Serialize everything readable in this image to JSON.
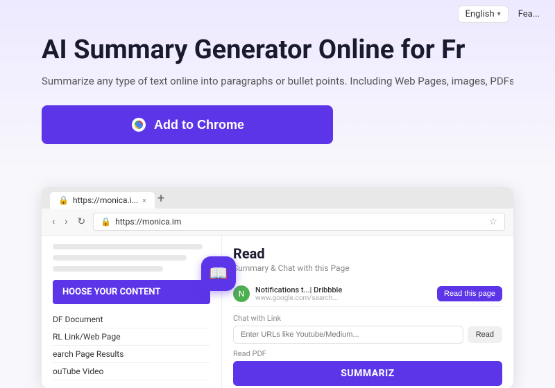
{
  "nav": {
    "language": "English",
    "chevron": "▾",
    "features": "Fea..."
  },
  "hero": {
    "title": "AI Summary Generator Online for Fr",
    "subtitle": "Summarize any type of text online into paragraphs or bullet points. Including Web Pages, images, PDFs, and YouTube"
  },
  "cta": {
    "add_to_chrome": "Add to Chrome"
  },
  "browser": {
    "traffic_lights": [
      "red",
      "yellow",
      "green"
    ],
    "tab_url": "https://monica.i...",
    "tab_close": "×",
    "tab_add": "+",
    "address": "https://monica.im"
  },
  "left_panel": {
    "choose_label": "HOOSE YOUR CONTENT",
    "menu_items": [
      "DF Document",
      "RL Link/Web Page",
      "earch Page Results",
      "ouTube Video"
    ]
  },
  "right_panel": {
    "title": "Read",
    "subtitle": "Summary & Chat with this Page",
    "notification_title": "Notifications t...| Dribbble",
    "notification_url": "www.google.com/search...",
    "read_this_page": "Read this page",
    "chat_with_link": "Chat with Link",
    "url_placeholder": "Enter URLs like Youtube/Medium...",
    "read_label": "Read",
    "read_pdf": "Read PDF",
    "summarize": "SUMMARIZ"
  }
}
